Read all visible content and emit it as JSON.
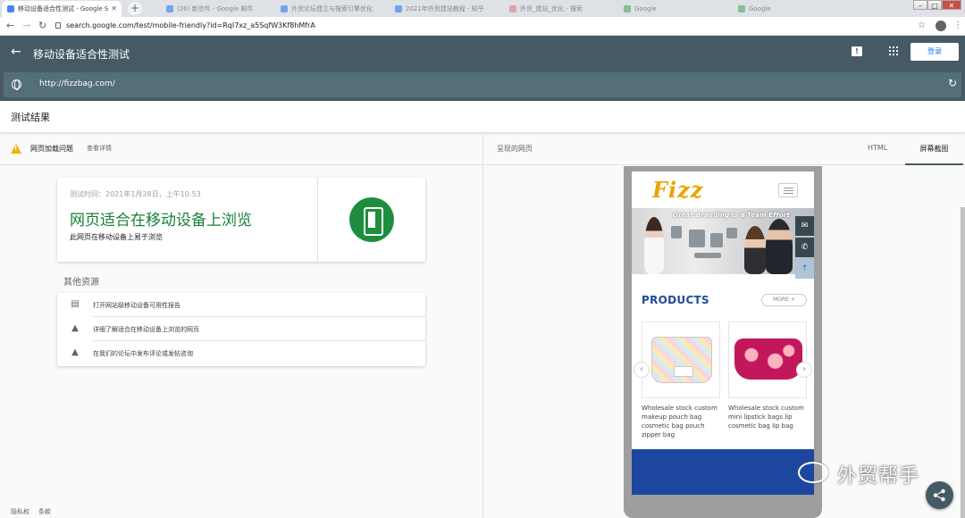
{
  "browser": {
    "active_tab_title": "移动设备适合性测试 - Google S",
    "tabs": [
      {
        "label": "(26) 新信件 - Google 邮件",
        "color": "#1a73e8"
      },
      {
        "label": "外贸论坛建立与搜索引擎优化",
        "color": "#1a73e8"
      },
      {
        "label": "2021年外贸建站教程 - 知乎",
        "color": "#1a73e8"
      },
      {
        "label": "外贸_建站_优化 - 搜索",
        "color": "#e57373"
      },
      {
        "label": "Google",
        "color": "#34a853"
      },
      {
        "label": "Google",
        "color": "#34a853"
      }
    ],
    "url": "search.google.com/test/mobile-friendly?id=RqI7xz_a5SqfW3Kf8hMfrA"
  },
  "header": {
    "title": "移动设备适合性测试",
    "login_label": "登录",
    "tested_url": "http://fizzbag.com/"
  },
  "results": {
    "title": "测试结果",
    "issue_label": "网页加载问题",
    "issue_link": "查看详情",
    "test_time": "测试时间：2021年1月28日，上午10:53",
    "headline": "网页适合在移动设备上浏览",
    "subline": "此网页在移动设备上易于浏览",
    "headline_color": "#188038"
  },
  "resources": {
    "title": "其他资源",
    "items": [
      {
        "label": "打开网站级移动设备可用性报告",
        "icon": "report-icon"
      },
      {
        "label": "详细了解适合在移动设备上浏览的网页",
        "icon": "school-icon"
      },
      {
        "label": "在我们的论坛中发布评论或发帖咨询",
        "icon": "school-icon"
      }
    ]
  },
  "footer": {
    "privacy": "隐私权",
    "terms": "条款"
  },
  "preview": {
    "rendered_label": "呈现的网页",
    "tab_html": "HTML",
    "tab_screenshot": "屏幕截图",
    "site": {
      "logo": "Fizz",
      "banner_text": "Great Branding Is a Team Effort",
      "products_title": "PRODUCTS",
      "more_label": "MORE +",
      "products": [
        {
          "caption": "Wholesale stock custom makeup pouch bag cosmetic bag pouch zipper bag"
        },
        {
          "caption": "Wholesale stock custom mini lipstick bags lip cosmetic bag lip bag"
        }
      ]
    }
  },
  "watermark": "外贸帮手"
}
